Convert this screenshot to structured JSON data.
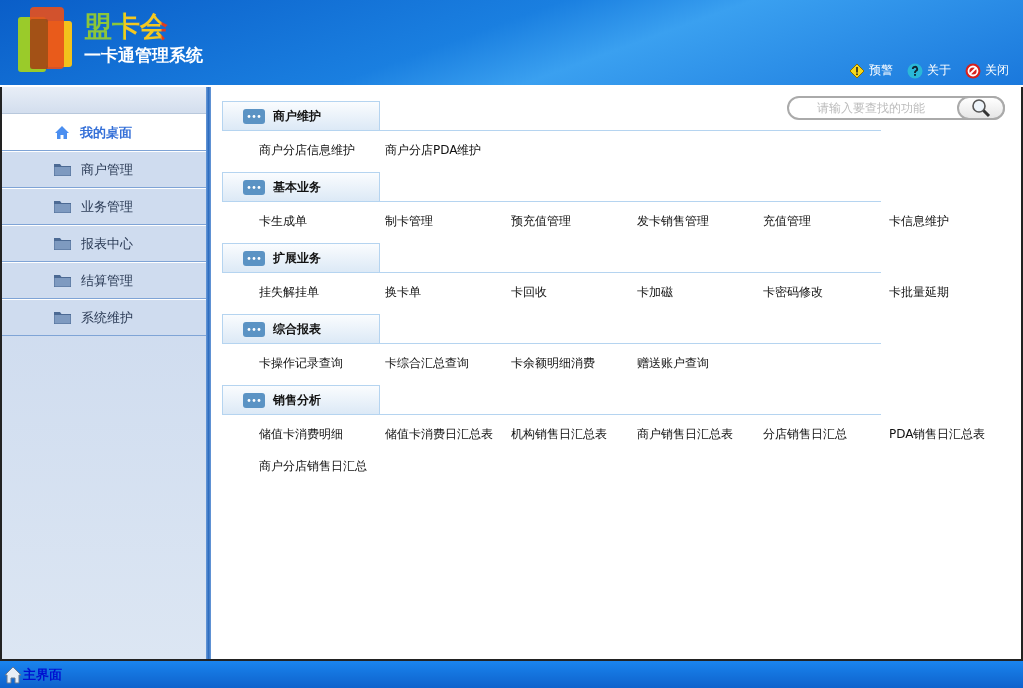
{
  "header": {
    "logo_title": "盟卡会",
    "subtitle": "一卡通管理系统",
    "links": [
      {
        "label": "预警",
        "kind": "warning"
      },
      {
        "label": "关于",
        "kind": "help"
      },
      {
        "label": "关闭",
        "kind": "close"
      }
    ]
  },
  "sidebar": {
    "items": [
      {
        "label": "我的桌面",
        "kind": "home",
        "selected": true
      },
      {
        "label": "商户管理",
        "kind": "folder",
        "selected": false
      },
      {
        "label": "业务管理",
        "kind": "folder",
        "selected": false
      },
      {
        "label": "报表中心",
        "kind": "folder",
        "selected": false
      },
      {
        "label": "结算管理",
        "kind": "folder",
        "selected": false
      },
      {
        "label": "系统维护",
        "kind": "folder",
        "selected": false
      }
    ]
  },
  "search": {
    "placeholder": "请输入要查找的功能"
  },
  "sections": [
    {
      "title": "商户维护",
      "items": [
        "商户分店信息维护",
        "商户分店PDA维护"
      ]
    },
    {
      "title": "基本业务",
      "items": [
        "卡生成单",
        "制卡管理",
        "预充值管理",
        "发卡销售管理",
        "充值管理",
        "卡信息维护"
      ]
    },
    {
      "title": "扩展业务",
      "items": [
        "挂失解挂单",
        "换卡单",
        "卡回收",
        "卡加磁",
        "卡密码修改",
        "卡批量延期"
      ]
    },
    {
      "title": "综合报表",
      "items": [
        "卡操作记录查询",
        "卡综合汇总查询",
        "卡余额明细消费",
        "赠送账户查询"
      ]
    },
    {
      "title": "销售分析",
      "items": [
        "储值卡消费明细",
        "储值卡消费日汇总表",
        "机构销售日汇总表",
        "商户销售日汇总表",
        "分店销售日汇总",
        "PDA销售日汇总表",
        "商户分店销售日汇总"
      ]
    }
  ],
  "footer": {
    "label": "主界面"
  }
}
